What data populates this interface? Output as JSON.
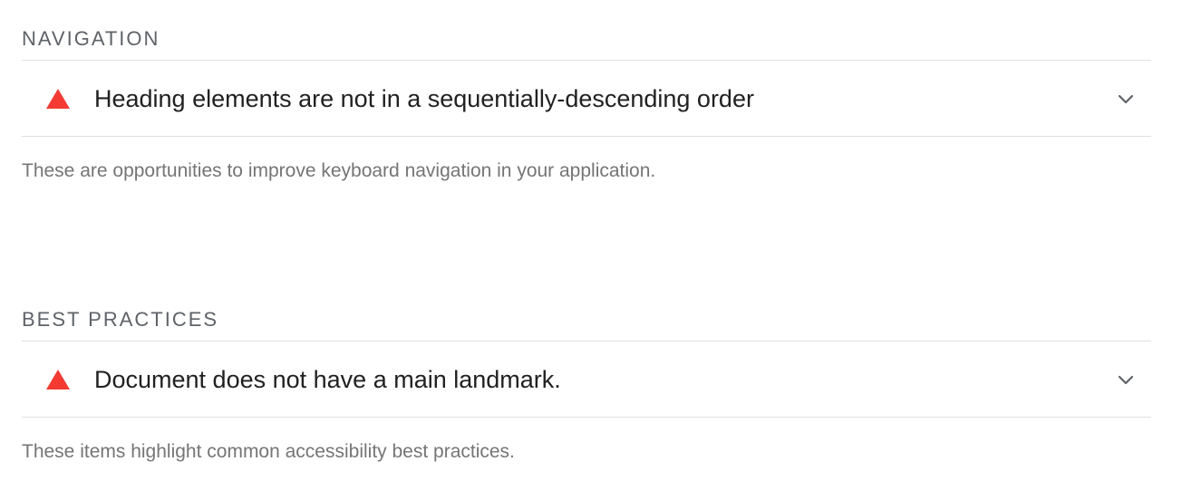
{
  "colors": {
    "fail": "#f33b33",
    "header": "#5f6368",
    "text": "#212121",
    "muted": "#757575",
    "divider": "#e0e0e0"
  },
  "sections": [
    {
      "title": "NAVIGATION",
      "audits": [
        {
          "status_icon": "fail-triangle-icon",
          "title": "Heading elements are not in a sequentially-descending order",
          "expand_icon": "chevron-down-icon"
        }
      ],
      "description": "These are opportunities to improve keyboard navigation in your application."
    },
    {
      "title": "BEST PRACTICES",
      "audits": [
        {
          "status_icon": "fail-triangle-icon",
          "title": "Document does not have a main landmark.",
          "expand_icon": "chevron-down-icon"
        }
      ],
      "description": "These items highlight common accessibility best practices."
    }
  ]
}
